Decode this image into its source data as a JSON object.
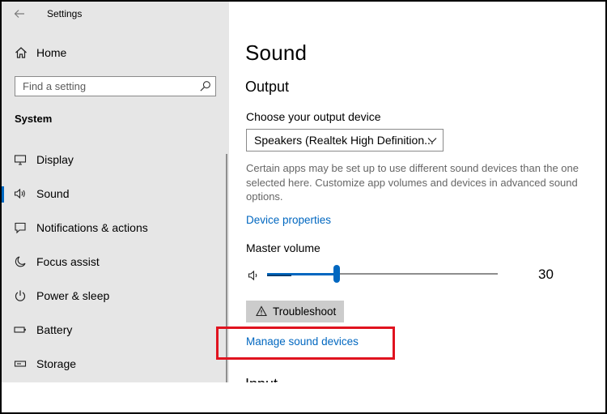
{
  "window": {
    "title": "Settings"
  },
  "sidebar": {
    "home_label": "Home",
    "search_placeholder": "Find a setting",
    "section_title": "System",
    "items": [
      {
        "label": "Display",
        "icon": "monitor-icon",
        "selected": false
      },
      {
        "label": "Sound",
        "icon": "speaker-icon",
        "selected": true
      },
      {
        "label": "Notifications & actions",
        "icon": "notification-icon",
        "selected": false
      },
      {
        "label": "Focus assist",
        "icon": "moon-icon",
        "selected": false
      },
      {
        "label": "Power & sleep",
        "icon": "power-icon",
        "selected": false
      },
      {
        "label": "Battery",
        "icon": "battery-icon",
        "selected": false
      },
      {
        "label": "Storage",
        "icon": "storage-icon",
        "selected": false
      }
    ]
  },
  "main": {
    "title": "Sound",
    "output_heading": "Output",
    "output_device_label": "Choose your output device",
    "output_device_value": "Speakers (Realtek High Definition...",
    "description": "Certain apps may be set up to use different sound devices than the one selected here. Customize app volumes and devices in advanced sound options.",
    "device_properties_link": "Device properties",
    "master_volume_label": "Master volume",
    "volume_value": 30,
    "volume_display": "30",
    "troubleshoot_label": "Troubleshoot",
    "manage_devices_link": "Manage sound devices",
    "input_heading": "Input"
  },
  "colors": {
    "accent": "#0067c0",
    "sidebar_bg": "#e6e6e6",
    "highlight": "#e0131f"
  }
}
